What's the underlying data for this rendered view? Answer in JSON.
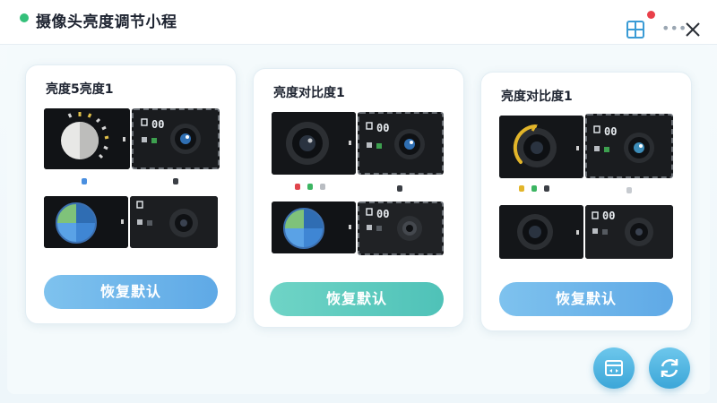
{
  "window": {
    "title": "摄像头亮度调节小程",
    "status_color": "#34c07a",
    "notification_color": "#e9404a",
    "icons": {
      "layout": "grid-icon",
      "more": "more-icon",
      "close": "close-icon"
    }
  },
  "cards": [
    {
      "title": "亮度5亮度1",
      "cam_labels": [
        "00",
        "00"
      ],
      "reset_label": "恢复默认",
      "button_color": "#6bb6ec"
    },
    {
      "title": "亮度对比度1",
      "cam_labels": [
        "00",
        "00"
      ],
      "reset_label": "恢复默认",
      "button_color": "#5ccfc2"
    },
    {
      "title": "亮度对比度1",
      "cam_labels": [
        "00",
        "00"
      ],
      "reset_label": "恢复默认",
      "button_color": "#6bb6ec"
    }
  ],
  "fab": {
    "layout_icon": "layout-toggle-icon",
    "refresh_icon": "refresh-icon"
  }
}
